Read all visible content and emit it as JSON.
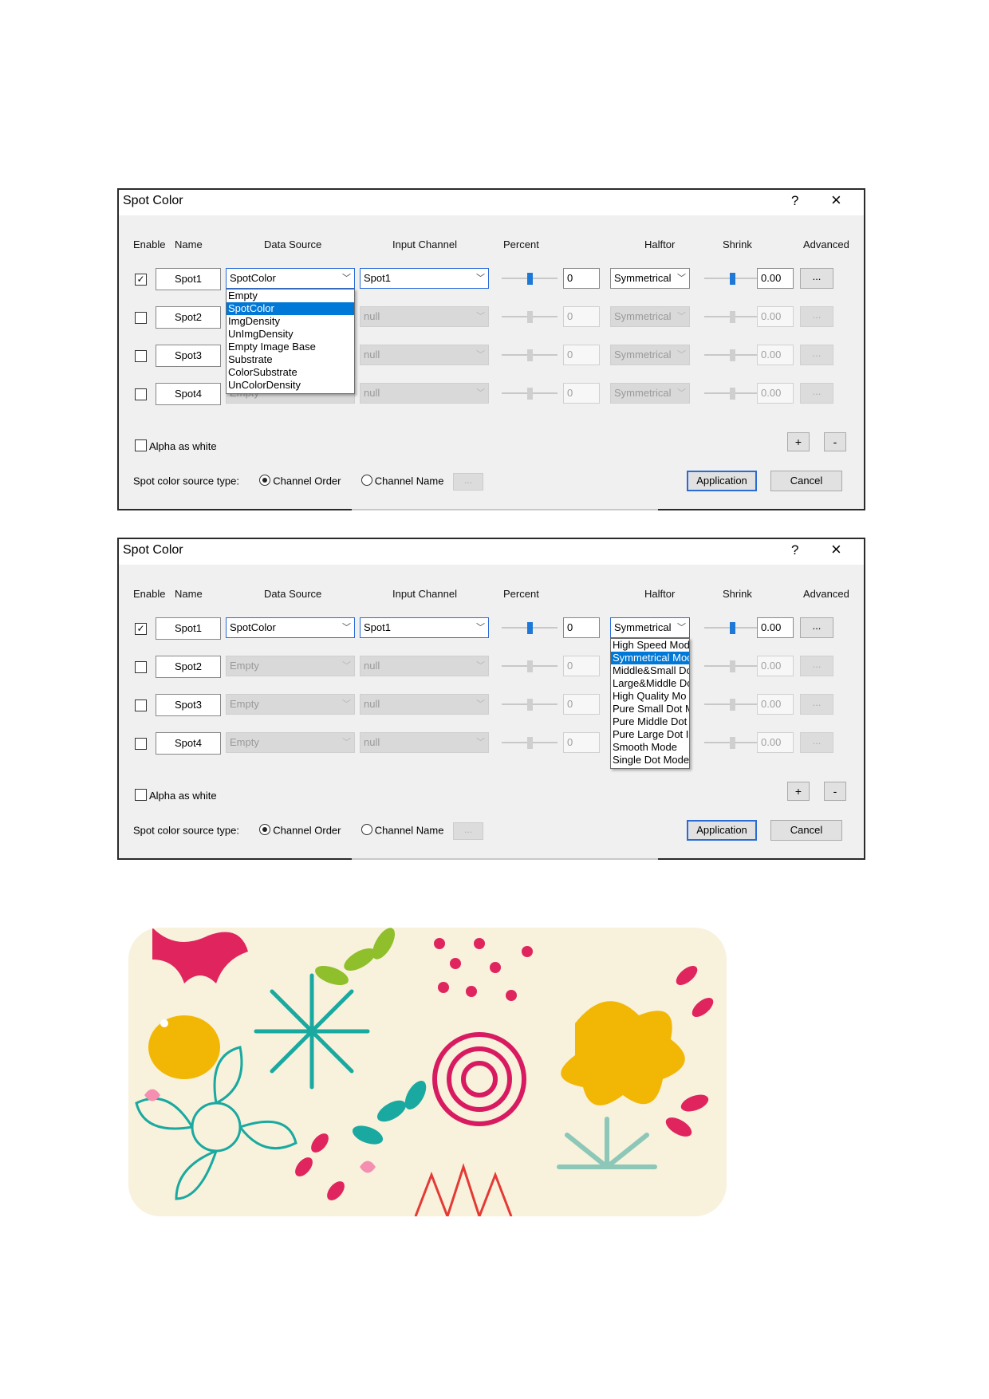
{
  "dialog1": {
    "title": "Spot Color",
    "help": "?",
    "close": "×",
    "headers": {
      "enable": "Enable",
      "name": "Name",
      "data_source": "Data Source",
      "input_channel": "Input Channel",
      "percent": "Percent",
      "halftone": "Halftor",
      "shrink": "Shrink",
      "advanced": "Advanced"
    },
    "rows": [
      {
        "checked": true,
        "name": "Spot1",
        "data_source": "SpotColor",
        "input_channel": "Spot1",
        "percent": "0",
        "halftone": "Symmetrical",
        "shrink": "0.00",
        "adv": "..."
      },
      {
        "checked": false,
        "name": "Spot2",
        "data_source": "",
        "input_channel": "null",
        "percent": "0",
        "halftone": "Symmetrical",
        "shrink": "0.00",
        "adv": "..."
      },
      {
        "checked": false,
        "name": "Spot3",
        "data_source": "",
        "input_channel": "null",
        "percent": "0",
        "halftone": "Symmetrical",
        "shrink": "0.00",
        "adv": "..."
      },
      {
        "checked": false,
        "name": "Spot4",
        "data_source": "Empty",
        "input_channel": "null",
        "percent": "0",
        "halftone": "Symmetrical",
        "shrink": "0.00",
        "adv": "..."
      }
    ],
    "dropdown": [
      "Empty",
      "SpotColor",
      "ImgDensity",
      "UnImgDensity",
      "Empty Image Base",
      "Substrate",
      "ColorSubstrate",
      "UnColorDensity"
    ],
    "dropdown_selected": 1,
    "alpha_label": "Alpha as white",
    "plus": "+",
    "minus": "-",
    "source_type_label": "Spot color source type:",
    "radio_order": "Channel Order",
    "radio_name": "Channel Name",
    "ellipsis": "...",
    "apply": "Application",
    "cancel": "Cancel"
  },
  "dialog2": {
    "title": "Spot Color",
    "help": "?",
    "close": "×",
    "headers": {
      "enable": "Enable",
      "name": "Name",
      "data_source": "Data Source",
      "input_channel": "Input Channel",
      "percent": "Percent",
      "halftone": "Halftor",
      "shrink": "Shrink",
      "advanced": "Advanced"
    },
    "rows": [
      {
        "checked": true,
        "name": "Spot1",
        "data_source": "SpotColor",
        "input_channel": "Spot1",
        "percent": "0",
        "halftone": "Symmetrical",
        "shrink": "0.00",
        "adv": "..."
      },
      {
        "checked": false,
        "name": "Spot2",
        "data_source": "Empty",
        "input_channel": "null",
        "percent": "0",
        "halftone": "",
        "shrink": "0.00",
        "adv": "..."
      },
      {
        "checked": false,
        "name": "Spot3",
        "data_source": "Empty",
        "input_channel": "null",
        "percent": "0",
        "halftone": "",
        "shrink": "0.00",
        "adv": "..."
      },
      {
        "checked": false,
        "name": "Spot4",
        "data_source": "Empty",
        "input_channel": "null",
        "percent": "0",
        "halftone": "",
        "shrink": "0.00",
        "adv": "..."
      }
    ],
    "dropdown": [
      "High Speed Mod",
      "Symmetrical Moc",
      "Middle&Small Do",
      "Large&Middle Dc",
      "High Quality Mo",
      "Pure Small Dot M",
      "Pure Middle Dot",
      "Pure Large Dot I",
      "Smooth Mode",
      "Single Dot Mode"
    ],
    "dropdown_selected": 1,
    "alpha_label": "Alpha as white",
    "plus": "+",
    "minus": "-",
    "source_type_label": "Spot color source type:",
    "radio_order": "Channel Order",
    "radio_name": "Channel Name",
    "ellipsis": "...",
    "apply": "Application",
    "cancel": "Cancel"
  },
  "colors": {
    "accent": "#0078d7",
    "magenta": "#e0245e",
    "teal": "#1aa9a0",
    "yellow": "#f2b705",
    "cream": "#f8f1dc"
  }
}
